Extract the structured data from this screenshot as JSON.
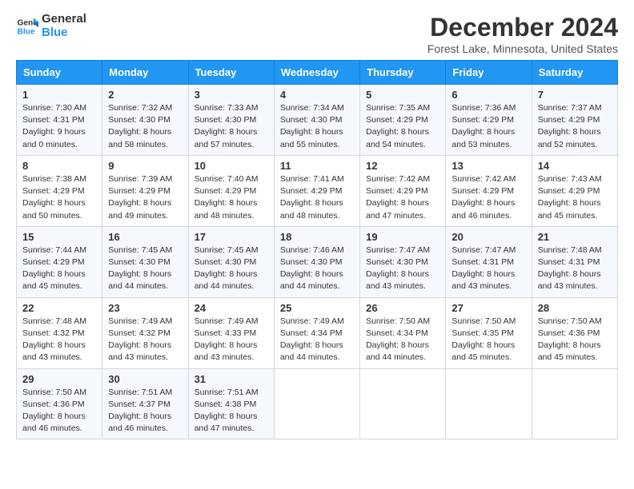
{
  "header": {
    "logo_line1": "General",
    "logo_line2": "Blue",
    "month": "December 2024",
    "location": "Forest Lake, Minnesota, United States"
  },
  "days_of_week": [
    "Sunday",
    "Monday",
    "Tuesday",
    "Wednesday",
    "Thursday",
    "Friday",
    "Saturday"
  ],
  "weeks": [
    [
      {
        "day": "1",
        "sunrise": "Sunrise: 7:30 AM",
        "sunset": "Sunset: 4:31 PM",
        "daylight": "Daylight: 9 hours and 0 minutes."
      },
      {
        "day": "2",
        "sunrise": "Sunrise: 7:32 AM",
        "sunset": "Sunset: 4:30 PM",
        "daylight": "Daylight: 8 hours and 58 minutes."
      },
      {
        "day": "3",
        "sunrise": "Sunrise: 7:33 AM",
        "sunset": "Sunset: 4:30 PM",
        "daylight": "Daylight: 8 hours and 57 minutes."
      },
      {
        "day": "4",
        "sunrise": "Sunrise: 7:34 AM",
        "sunset": "Sunset: 4:30 PM",
        "daylight": "Daylight: 8 hours and 55 minutes."
      },
      {
        "day": "5",
        "sunrise": "Sunrise: 7:35 AM",
        "sunset": "Sunset: 4:29 PM",
        "daylight": "Daylight: 8 hours and 54 minutes."
      },
      {
        "day": "6",
        "sunrise": "Sunrise: 7:36 AM",
        "sunset": "Sunset: 4:29 PM",
        "daylight": "Daylight: 8 hours and 53 minutes."
      },
      {
        "day": "7",
        "sunrise": "Sunrise: 7:37 AM",
        "sunset": "Sunset: 4:29 PM",
        "daylight": "Daylight: 8 hours and 52 minutes."
      }
    ],
    [
      {
        "day": "8",
        "sunrise": "Sunrise: 7:38 AM",
        "sunset": "Sunset: 4:29 PM",
        "daylight": "Daylight: 8 hours and 50 minutes."
      },
      {
        "day": "9",
        "sunrise": "Sunrise: 7:39 AM",
        "sunset": "Sunset: 4:29 PM",
        "daylight": "Daylight: 8 hours and 49 minutes."
      },
      {
        "day": "10",
        "sunrise": "Sunrise: 7:40 AM",
        "sunset": "Sunset: 4:29 PM",
        "daylight": "Daylight: 8 hours and 48 minutes."
      },
      {
        "day": "11",
        "sunrise": "Sunrise: 7:41 AM",
        "sunset": "Sunset: 4:29 PM",
        "daylight": "Daylight: 8 hours and 48 minutes."
      },
      {
        "day": "12",
        "sunrise": "Sunrise: 7:42 AM",
        "sunset": "Sunset: 4:29 PM",
        "daylight": "Daylight: 8 hours and 47 minutes."
      },
      {
        "day": "13",
        "sunrise": "Sunrise: 7:42 AM",
        "sunset": "Sunset: 4:29 PM",
        "daylight": "Daylight: 8 hours and 46 minutes."
      },
      {
        "day": "14",
        "sunrise": "Sunrise: 7:43 AM",
        "sunset": "Sunset: 4:29 PM",
        "daylight": "Daylight: 8 hours and 45 minutes."
      }
    ],
    [
      {
        "day": "15",
        "sunrise": "Sunrise: 7:44 AM",
        "sunset": "Sunset: 4:29 PM",
        "daylight": "Daylight: 8 hours and 45 minutes."
      },
      {
        "day": "16",
        "sunrise": "Sunrise: 7:45 AM",
        "sunset": "Sunset: 4:30 PM",
        "daylight": "Daylight: 8 hours and 44 minutes."
      },
      {
        "day": "17",
        "sunrise": "Sunrise: 7:45 AM",
        "sunset": "Sunset: 4:30 PM",
        "daylight": "Daylight: 8 hours and 44 minutes."
      },
      {
        "day": "18",
        "sunrise": "Sunrise: 7:46 AM",
        "sunset": "Sunset: 4:30 PM",
        "daylight": "Daylight: 8 hours and 44 minutes."
      },
      {
        "day": "19",
        "sunrise": "Sunrise: 7:47 AM",
        "sunset": "Sunset: 4:30 PM",
        "daylight": "Daylight: 8 hours and 43 minutes."
      },
      {
        "day": "20",
        "sunrise": "Sunrise: 7:47 AM",
        "sunset": "Sunset: 4:31 PM",
        "daylight": "Daylight: 8 hours and 43 minutes."
      },
      {
        "day": "21",
        "sunrise": "Sunrise: 7:48 AM",
        "sunset": "Sunset: 4:31 PM",
        "daylight": "Daylight: 8 hours and 43 minutes."
      }
    ],
    [
      {
        "day": "22",
        "sunrise": "Sunrise: 7:48 AM",
        "sunset": "Sunset: 4:32 PM",
        "daylight": "Daylight: 8 hours and 43 minutes."
      },
      {
        "day": "23",
        "sunrise": "Sunrise: 7:49 AM",
        "sunset": "Sunset: 4:32 PM",
        "daylight": "Daylight: 8 hours and 43 minutes."
      },
      {
        "day": "24",
        "sunrise": "Sunrise: 7:49 AM",
        "sunset": "Sunset: 4:33 PM",
        "daylight": "Daylight: 8 hours and 43 minutes."
      },
      {
        "day": "25",
        "sunrise": "Sunrise: 7:49 AM",
        "sunset": "Sunset: 4:34 PM",
        "daylight": "Daylight: 8 hours and 44 minutes."
      },
      {
        "day": "26",
        "sunrise": "Sunrise: 7:50 AM",
        "sunset": "Sunset: 4:34 PM",
        "daylight": "Daylight: 8 hours and 44 minutes."
      },
      {
        "day": "27",
        "sunrise": "Sunrise: 7:50 AM",
        "sunset": "Sunset: 4:35 PM",
        "daylight": "Daylight: 8 hours and 45 minutes."
      },
      {
        "day": "28",
        "sunrise": "Sunrise: 7:50 AM",
        "sunset": "Sunset: 4:36 PM",
        "daylight": "Daylight: 8 hours and 45 minutes."
      }
    ],
    [
      {
        "day": "29",
        "sunrise": "Sunrise: 7:50 AM",
        "sunset": "Sunset: 4:36 PM",
        "daylight": "Daylight: 8 hours and 46 minutes."
      },
      {
        "day": "30",
        "sunrise": "Sunrise: 7:51 AM",
        "sunset": "Sunset: 4:37 PM",
        "daylight": "Daylight: 8 hours and 46 minutes."
      },
      {
        "day": "31",
        "sunrise": "Sunrise: 7:51 AM",
        "sunset": "Sunset: 4:38 PM",
        "daylight": "Daylight: 8 hours and 47 minutes."
      },
      null,
      null,
      null,
      null
    ]
  ]
}
